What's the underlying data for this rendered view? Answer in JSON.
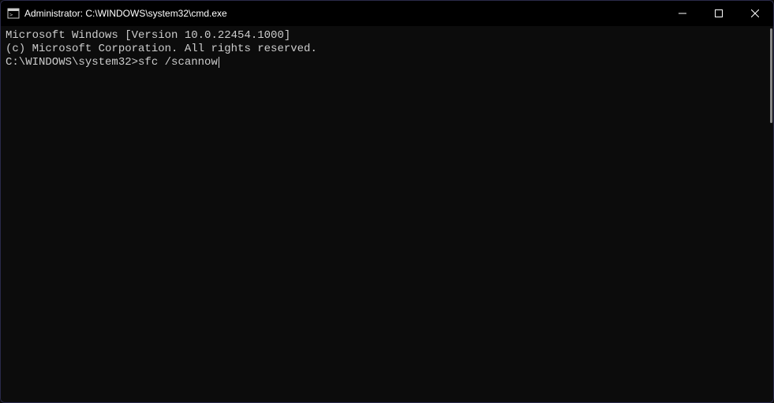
{
  "titlebar": {
    "title": "Administrator: C:\\WINDOWS\\system32\\cmd.exe"
  },
  "terminal": {
    "line1": "Microsoft Windows [Version 10.0.22454.1000]",
    "line2": "(c) Microsoft Corporation. All rights reserved.",
    "blank": "",
    "prompt": "C:\\WINDOWS\\system32>",
    "command": "sfc /scannow"
  }
}
